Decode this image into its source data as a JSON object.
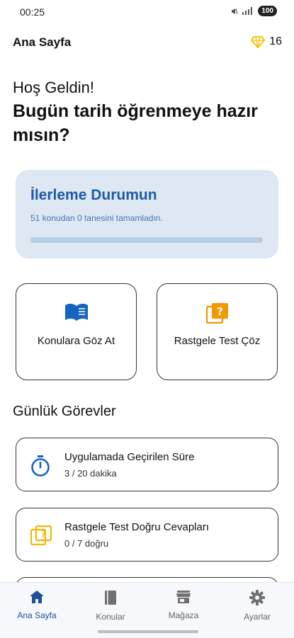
{
  "status_bar": {
    "time": "00:25",
    "battery": "100"
  },
  "header": {
    "title": "Ana Sayfa",
    "gems": "16"
  },
  "greeting": "Hoş Geldin!",
  "headline": "Bugün tarih öğrenmeye hazır mısın?",
  "progress": {
    "title": "İlerleme Durumun",
    "description": "51 konudan 0 tanesini tamamladın.",
    "completed": 0,
    "total": 51
  },
  "actions": [
    {
      "label": "Konulara Göz At",
      "icon": "book-icon",
      "color": "#1565c0"
    },
    {
      "label": "Rastgele Test Çöz",
      "icon": "quiz-icon",
      "color": "#f29900"
    }
  ],
  "daily_tasks": {
    "title": "Günlük Görevler",
    "items": [
      {
        "title": "Uygulamada Geçirilen Süre",
        "subtitle": "3 / 20 dakika",
        "icon": "timer-icon",
        "color": "#1565c0"
      },
      {
        "title": "Rastgele Test Doğru Cevapları",
        "subtitle": "0 / 7 doğru",
        "icon": "quiz-icon",
        "color": "#f2b600"
      }
    ]
  },
  "nav": [
    {
      "label": "Ana Sayfa",
      "icon": "home-icon",
      "active": true
    },
    {
      "label": "Konular",
      "icon": "book-icon",
      "active": false
    },
    {
      "label": "Mağaza",
      "icon": "store-icon",
      "active": false
    },
    {
      "label": "Ayarlar",
      "icon": "gear-icon",
      "active": false
    }
  ],
  "colors": {
    "accent": "#1e4f9c",
    "gem": "#f5c400"
  }
}
